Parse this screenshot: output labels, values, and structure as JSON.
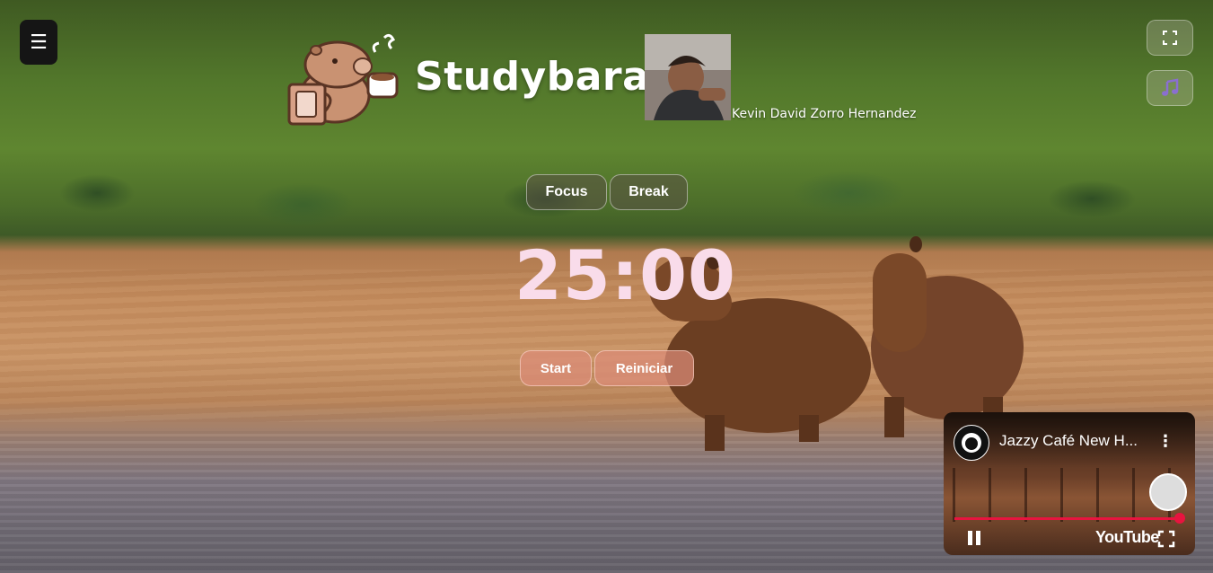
{
  "app": {
    "title": "Studybara",
    "author": "Kevin David Zorro Hernandez"
  },
  "controls": {
    "menu_icon": "☰",
    "fullscreen_icon": "fullscreen-icon",
    "music_icon": "music-note-icon"
  },
  "modes": {
    "focus_label": "Focus",
    "break_label": "Break"
  },
  "timer": {
    "display": "25:00"
  },
  "actions": {
    "start_label": "Start",
    "reset_label": "Reiniciar"
  },
  "player": {
    "video_title": "Jazzy Café New H...",
    "brand": "YouTube",
    "progress": 0.98,
    "accent": "#e8143f"
  },
  "colors": {
    "timer": "#f9dcea",
    "action_button": "#dc8c78"
  }
}
